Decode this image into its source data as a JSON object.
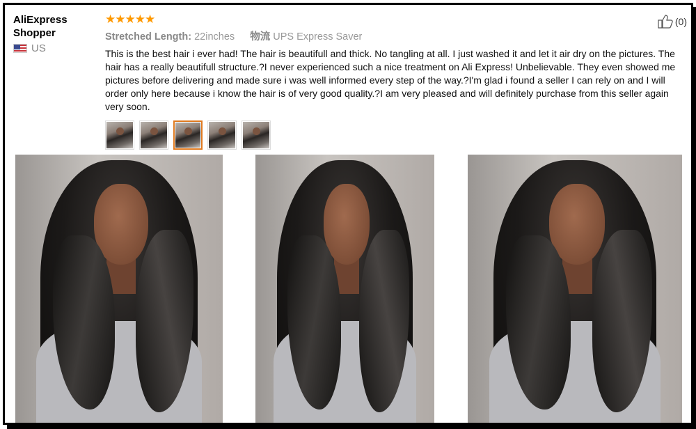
{
  "reviewer": {
    "name": "AliExpress Shopper",
    "country": "US",
    "flag_icon": "us-flag-icon"
  },
  "review": {
    "stars": "★★★★★",
    "star_color": "#ff9900",
    "rating": 5,
    "attr_label": "Stretched Length:",
    "attr_value": "22inches",
    "shipping_label": "物流",
    "shipping_value": "UPS Express Saver",
    "text": "This is the best hair i ever had! The hair is beautifull and thick. No tangling at all. I just washed it and let it air dry on the pictures. The hair has a really beautifull structure.?I never experienced such a nice treatment on Ali Express! Unbelievable. They even showed me pictures before delivering and made sure i was well informed every step of the way.?I'm glad i found a seller I can rely on and I will order only here because i know the hair is of very good quality.?I am very pleased and will definitely purchase from this seller again very soon.",
    "helpful_count": "(0)",
    "helpful_icon": "thumbs-up-icon",
    "thumbnails": [
      {
        "active": false
      },
      {
        "active": false
      },
      {
        "active": true
      },
      {
        "active": false
      },
      {
        "active": false
      }
    ],
    "active_thumb_color": "#e07a1f"
  }
}
